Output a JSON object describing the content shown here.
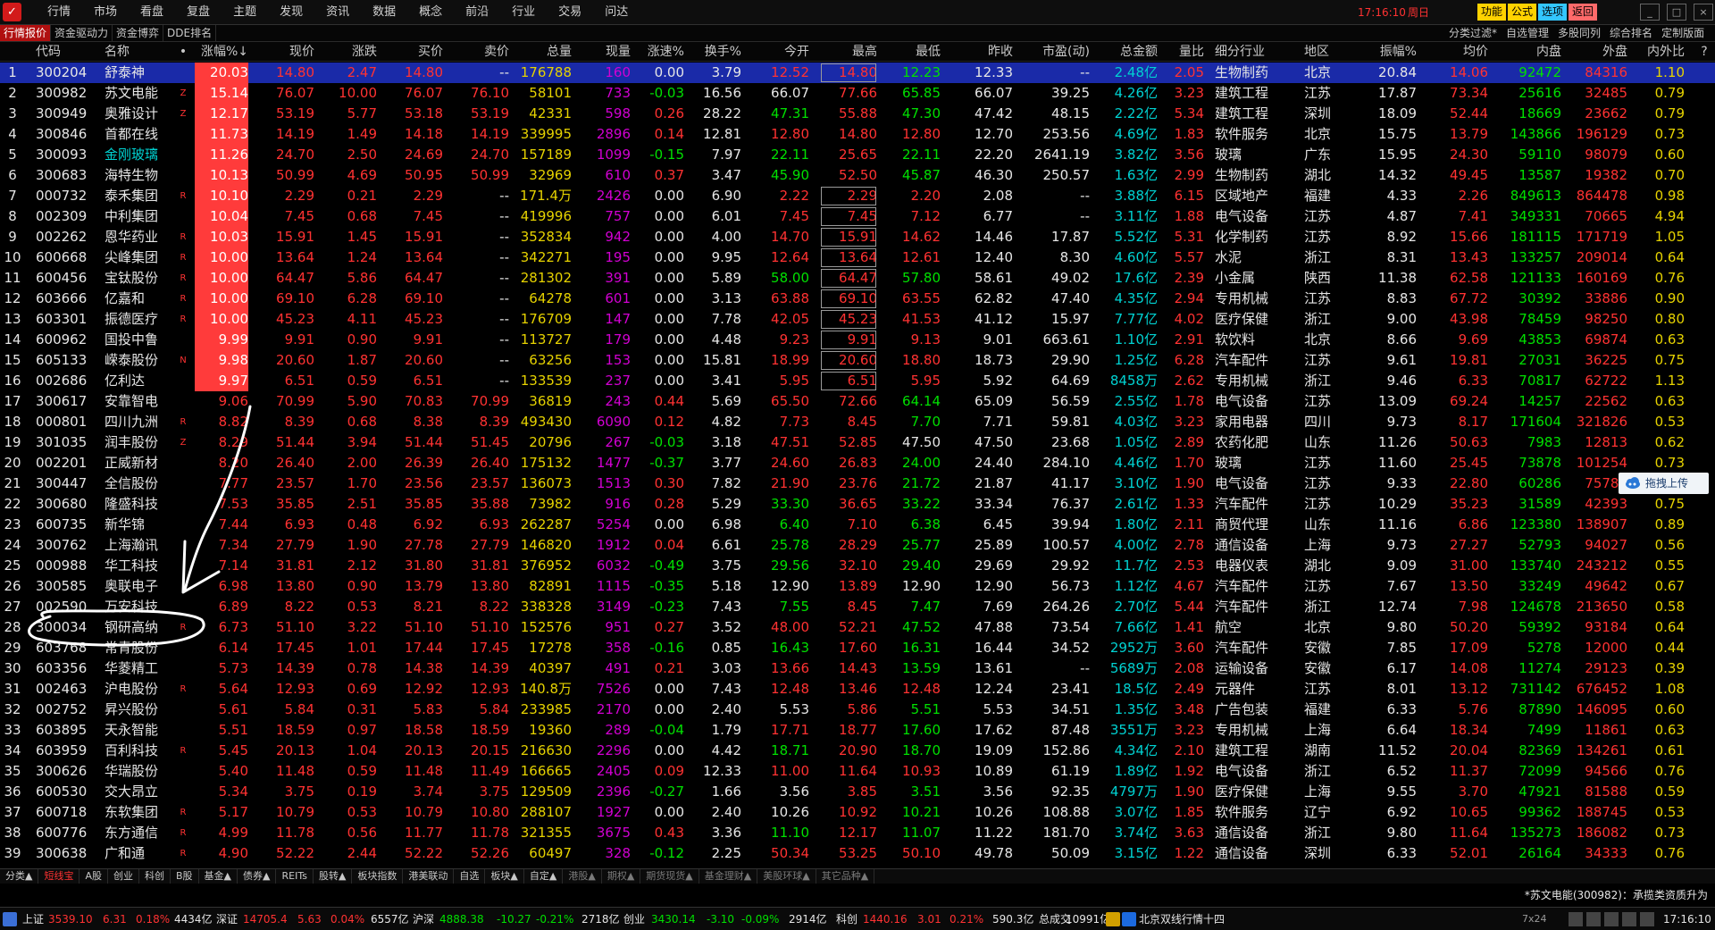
{
  "app": {
    "logo_text": "✓",
    "menu": [
      "行情",
      "市场",
      "看盘",
      "复盘",
      "主题",
      "发现",
      "资讯",
      "数据",
      "概念",
      "前沿",
      "行业",
      "交易",
      "问达"
    ],
    "time": "17:16:10",
    "weekday": "周日",
    "top_buttons": [
      {
        "label": "功能",
        "color": "#ffd200"
      },
      {
        "label": "公式",
        "color": "#ffd200"
      },
      {
        "label": "选项",
        "color": "#33c6ff"
      },
      {
        "label": "返回",
        "color": "#ff6a6a"
      }
    ],
    "window_controls": [
      "_",
      "□",
      "×"
    ]
  },
  "tabs": {
    "left": [
      "行情报价",
      "资金驱动力",
      "资金博弈",
      "DDE排名"
    ],
    "right": [
      "分类过滤*",
      "自选管理",
      "多股同列",
      "综合排名",
      "定制版面"
    ]
  },
  "table": {
    "headers": [
      "",
      "代码",
      "名称",
      "•",
      "涨幅%↓",
      "现价",
      "涨跌",
      "买价",
      "卖价",
      "总量",
      "现量",
      "涨速%",
      "换手%",
      "今开",
      "最高",
      "最低",
      "昨收",
      "市盈(动)",
      "总金额",
      "量比",
      "细分行业",
      "地区",
      "振幅%",
      "均价",
      "内盘",
      "外盘",
      "内外比",
      "?"
    ],
    "rows": [
      [
        "1",
        "300204",
        "舒泰神",
        "",
        "20.03",
        "14.80",
        "2.47",
        "14.80",
        "--",
        "176788",
        "160",
        "0.00",
        "3.79",
        "12.52",
        "14.80",
        "12.23",
        "12.33",
        "--",
        "2.48亿",
        "2.05",
        "生物制药",
        "北京",
        "20.84",
        "14.06",
        "92472",
        "84316",
        "1.10"
      ],
      [
        "2",
        "300982",
        "苏文电能",
        "Z",
        "15.14",
        "76.07",
        "10.00",
        "76.07",
        "76.10",
        "58101",
        "733",
        "-0.03",
        "16.56",
        "66.07",
        "77.66",
        "65.85",
        "66.07",
        "39.25",
        "4.26亿",
        "3.23",
        "建筑工程",
        "江苏",
        "17.87",
        "73.34",
        "25616",
        "32485",
        "0.79"
      ],
      [
        "3",
        "300949",
        "奥雅设计",
        "Z",
        "12.17",
        "53.19",
        "5.77",
        "53.18",
        "53.19",
        "42331",
        "598",
        "0.26",
        "28.22",
        "47.31",
        "55.88",
        "47.30",
        "47.42",
        "48.15",
        "2.22亿",
        "5.34",
        "建筑工程",
        "深圳",
        "18.09",
        "52.44",
        "18669",
        "23662",
        "0.79"
      ],
      [
        "4",
        "300846",
        "首都在线",
        "",
        "11.73",
        "14.19",
        "1.49",
        "14.18",
        "14.19",
        "339995",
        "2896",
        "0.14",
        "12.81",
        "12.80",
        "14.80",
        "12.80",
        "12.70",
        "253.56",
        "4.69亿",
        "1.83",
        "软件服务",
        "北京",
        "15.75",
        "13.79",
        "143866",
        "196129",
        "0.73"
      ],
      [
        "5",
        "300093",
        "金刚玻璃",
        "",
        "11.26",
        "24.70",
        "2.50",
        "24.69",
        "24.70",
        "157189",
        "1099",
        "-0.15",
        "7.97",
        "22.11",
        "25.65",
        "22.11",
        "22.20",
        "2641.19",
        "3.82亿",
        "3.56",
        "玻璃",
        "广东",
        "15.95",
        "24.30",
        "59110",
        "98079",
        "0.60"
      ],
      [
        "6",
        "300683",
        "海特生物",
        "",
        "10.13",
        "50.99",
        "4.69",
        "50.95",
        "50.99",
        "32969",
        "610",
        "0.37",
        "3.47",
        "45.90",
        "52.50",
        "45.87",
        "46.30",
        "250.57",
        "1.63亿",
        "2.99",
        "生物制药",
        "湖北",
        "14.32",
        "49.45",
        "13587",
        "19382",
        "0.70"
      ],
      [
        "7",
        "000732",
        "泰禾集团",
        "R",
        "10.10",
        "2.29",
        "0.21",
        "2.29",
        "--",
        "171.4万",
        "2426",
        "0.00",
        "6.90",
        "2.22",
        "2.29",
        "2.20",
        "2.08",
        "--",
        "3.88亿",
        "6.15",
        "区域地产",
        "福建",
        "4.33",
        "2.26",
        "849613",
        "864478",
        "0.98"
      ],
      [
        "8",
        "002309",
        "中利集团",
        "",
        "10.04",
        "7.45",
        "0.68",
        "7.45",
        "--",
        "419996",
        "757",
        "0.00",
        "6.01",
        "7.45",
        "7.45",
        "7.12",
        "6.77",
        "--",
        "3.11亿",
        "1.88",
        "电气设备",
        "江苏",
        "4.87",
        "7.41",
        "349331",
        "70665",
        "4.94"
      ],
      [
        "9",
        "002262",
        "恩华药业",
        "R",
        "10.03",
        "15.91",
        "1.45",
        "15.91",
        "--",
        "352834",
        "942",
        "0.00",
        "4.00",
        "14.70",
        "15.91",
        "14.62",
        "14.46",
        "17.87",
        "5.52亿",
        "5.31",
        "化学制药",
        "江苏",
        "8.92",
        "15.66",
        "181115",
        "171719",
        "1.05"
      ],
      [
        "10",
        "600668",
        "尖峰集团",
        "R",
        "10.00",
        "13.64",
        "1.24",
        "13.64",
        "--",
        "342271",
        "195",
        "0.00",
        "9.95",
        "12.64",
        "13.64",
        "12.61",
        "12.40",
        "8.30",
        "4.60亿",
        "5.57",
        "水泥",
        "浙江",
        "8.31",
        "13.43",
        "133257",
        "209014",
        "0.64"
      ],
      [
        "11",
        "600456",
        "宝钛股份",
        "R",
        "10.00",
        "64.47",
        "5.86",
        "64.47",
        "--",
        "281302",
        "391",
        "0.00",
        "5.89",
        "58.00",
        "64.47",
        "57.80",
        "58.61",
        "49.02",
        "17.6亿",
        "2.39",
        "小金属",
        "陕西",
        "11.38",
        "62.58",
        "121133",
        "160169",
        "0.76"
      ],
      [
        "12",
        "603666",
        "亿嘉和",
        "R",
        "10.00",
        "69.10",
        "6.28",
        "69.10",
        "--",
        "64278",
        "601",
        "0.00",
        "3.13",
        "63.88",
        "69.10",
        "63.55",
        "62.82",
        "47.40",
        "4.35亿",
        "2.94",
        "专用机械",
        "江苏",
        "8.83",
        "67.72",
        "30392",
        "33886",
        "0.90"
      ],
      [
        "13",
        "603301",
        "振德医疗",
        "R",
        "10.00",
        "45.23",
        "4.11",
        "45.23",
        "--",
        "176709",
        "147",
        "0.00",
        "7.78",
        "42.05",
        "45.23",
        "41.53",
        "41.12",
        "15.97",
        "7.77亿",
        "4.02",
        "医疗保健",
        "浙江",
        "9.00",
        "43.98",
        "78459",
        "98250",
        "0.80"
      ],
      [
        "14",
        "600962",
        "国投中鲁",
        "",
        "9.99",
        "9.91",
        "0.90",
        "9.91",
        "--",
        "113727",
        "179",
        "0.00",
        "4.48",
        "9.23",
        "9.91",
        "9.13",
        "9.01",
        "663.61",
        "1.10亿",
        "2.91",
        "软饮料",
        "北京",
        "8.66",
        "9.69",
        "43853",
        "69874",
        "0.63"
      ],
      [
        "15",
        "605133",
        "嵘泰股份",
        "N",
        "9.98",
        "20.60",
        "1.87",
        "20.60",
        "--",
        "63256",
        "153",
        "0.00",
        "15.81",
        "18.99",
        "20.60",
        "18.80",
        "18.73",
        "29.90",
        "1.25亿",
        "6.28",
        "汽车配件",
        "江苏",
        "9.61",
        "19.81",
        "27031",
        "36225",
        "0.75"
      ],
      [
        "16",
        "002686",
        "亿利达",
        "",
        "9.97",
        "6.51",
        "0.59",
        "6.51",
        "--",
        "133539",
        "237",
        "0.00",
        "3.41",
        "5.95",
        "6.51",
        "5.95",
        "5.92",
        "64.69",
        "8458万",
        "2.62",
        "专用机械",
        "浙江",
        "9.46",
        "6.33",
        "70817",
        "62722",
        "1.13"
      ],
      [
        "17",
        "300617",
        "安靠智电",
        "",
        "9.06",
        "70.99",
        "5.90",
        "70.83",
        "70.99",
        "36819",
        "243",
        "0.44",
        "5.69",
        "65.50",
        "72.66",
        "64.14",
        "65.09",
        "56.59",
        "2.55亿",
        "1.78",
        "电气设备",
        "江苏",
        "13.09",
        "69.24",
        "14257",
        "22562",
        "0.63"
      ],
      [
        "18",
        "000801",
        "四川九洲",
        "R",
        "8.82",
        "8.39",
        "0.68",
        "8.38",
        "8.39",
        "493430",
        "6090",
        "0.12",
        "4.82",
        "7.73",
        "8.45",
        "7.70",
        "7.71",
        "59.81",
        "4.03亿",
        "3.23",
        "家用电器",
        "四川",
        "9.73",
        "8.17",
        "171604",
        "321826",
        "0.53"
      ],
      [
        "19",
        "301035",
        "润丰股份",
        "Z",
        "8.29",
        "51.44",
        "3.94",
        "51.44",
        "51.45",
        "20796",
        "267",
        "-0.03",
        "3.18",
        "47.51",
        "52.85",
        "47.50",
        "47.50",
        "23.68",
        "1.05亿",
        "2.89",
        "农药化肥",
        "山东",
        "11.26",
        "50.63",
        "7983",
        "12813",
        "0.62"
      ],
      [
        "20",
        "002201",
        "正威新材",
        "",
        "8.20",
        "26.40",
        "2.00",
        "26.39",
        "26.40",
        "175132",
        "1477",
        "-0.37",
        "3.77",
        "24.60",
        "26.83",
        "24.00",
        "24.40",
        "284.10",
        "4.46亿",
        "1.70",
        "玻璃",
        "江苏",
        "11.60",
        "25.45",
        "73878",
        "101254",
        "0.73"
      ],
      [
        "21",
        "300447",
        "全信股份",
        "",
        "7.77",
        "23.57",
        "1.70",
        "23.56",
        "23.57",
        "136073",
        "1513",
        "0.30",
        "7.82",
        "21.90",
        "23.76",
        "21.72",
        "21.87",
        "41.17",
        "3.10亿",
        "1.90",
        "电气设备",
        "江苏",
        "9.33",
        "22.80",
        "60286",
        "75787",
        "0.80"
      ],
      [
        "22",
        "300680",
        "隆盛科技",
        "",
        "7.53",
        "35.85",
        "2.51",
        "35.85",
        "35.88",
        "73982",
        "916",
        "0.28",
        "5.29",
        "33.30",
        "36.65",
        "33.22",
        "33.34",
        "76.37",
        "2.61亿",
        "1.33",
        "汽车配件",
        "江苏",
        "10.29",
        "35.23",
        "31589",
        "42393",
        "0.75"
      ],
      [
        "23",
        "600735",
        "新华锦",
        "",
        "7.44",
        "6.93",
        "0.48",
        "6.92",
        "6.93",
        "262287",
        "5254",
        "0.00",
        "6.98",
        "6.40",
        "7.10",
        "6.38",
        "6.45",
        "39.94",
        "1.80亿",
        "2.11",
        "商贸代理",
        "山东",
        "11.16",
        "6.86",
        "123380",
        "138907",
        "0.89"
      ],
      [
        "24",
        "300762",
        "上海瀚讯",
        "",
        "7.34",
        "27.79",
        "1.90",
        "27.78",
        "27.79",
        "146820",
        "1912",
        "0.04",
        "6.61",
        "25.78",
        "28.29",
        "25.77",
        "25.89",
        "100.57",
        "4.00亿",
        "2.78",
        "通信设备",
        "上海",
        "9.73",
        "27.27",
        "52793",
        "94027",
        "0.56"
      ],
      [
        "25",
        "000988",
        "华工科技",
        "",
        "7.14",
        "31.81",
        "2.12",
        "31.80",
        "31.81",
        "376952",
        "6032",
        "-0.49",
        "3.75",
        "29.56",
        "32.10",
        "29.40",
        "29.69",
        "29.92",
        "11.7亿",
        "2.53",
        "电器仪表",
        "湖北",
        "9.09",
        "31.00",
        "133740",
        "243212",
        "0.55"
      ],
      [
        "26",
        "300585",
        "奥联电子",
        "",
        "6.98",
        "13.80",
        "0.90",
        "13.79",
        "13.80",
        "82891",
        "1115",
        "-0.35",
        "5.18",
        "12.90",
        "13.89",
        "12.90",
        "12.90",
        "56.73",
        "1.12亿",
        "4.67",
        "汽车配件",
        "江苏",
        "7.67",
        "13.50",
        "33249",
        "49642",
        "0.67"
      ],
      [
        "27",
        "002590",
        "万安科技",
        "",
        "6.89",
        "8.22",
        "0.53",
        "8.21",
        "8.22",
        "338328",
        "3149",
        "-0.23",
        "7.43",
        "7.55",
        "8.45",
        "7.47",
        "7.69",
        "264.26",
        "2.70亿",
        "5.44",
        "汽车配件",
        "浙江",
        "12.74",
        "7.98",
        "124678",
        "213650",
        "0.58"
      ],
      [
        "28",
        "300034",
        "钢研高纳",
        "R",
        "6.73",
        "51.10",
        "3.22",
        "51.10",
        "51.10",
        "152576",
        "951",
        "0.27",
        "3.52",
        "48.00",
        "52.21",
        "47.52",
        "47.88",
        "73.54",
        "7.66亿",
        "1.41",
        "航空",
        "北京",
        "9.80",
        "50.20",
        "59392",
        "93184",
        "0.64"
      ],
      [
        "29",
        "603768",
        "常青股份",
        "",
        "6.14",
        "17.45",
        "1.01",
        "17.44",
        "17.45",
        "17278",
        "358",
        "-0.16",
        "0.85",
        "16.43",
        "17.60",
        "16.31",
        "16.44",
        "34.52",
        "2952万",
        "3.60",
        "汽车配件",
        "安徽",
        "7.85",
        "17.09",
        "5278",
        "12000",
        "0.44"
      ],
      [
        "30",
        "603356",
        "华菱精工",
        "",
        "5.73",
        "14.39",
        "0.78",
        "14.38",
        "14.39",
        "40397",
        "491",
        "0.21",
        "3.03",
        "13.66",
        "14.43",
        "13.59",
        "13.61",
        "--",
        "5689万",
        "2.08",
        "运输设备",
        "安徽",
        "6.17",
        "14.08",
        "11274",
        "29123",
        "0.39"
      ],
      [
        "31",
        "002463",
        "沪电股份",
        "R",
        "5.64",
        "12.93",
        "0.69",
        "12.92",
        "12.93",
        "140.8万",
        "7526",
        "0.00",
        "7.43",
        "12.48",
        "13.46",
        "12.48",
        "12.24",
        "23.41",
        "18.5亿",
        "2.49",
        "元器件",
        "江苏",
        "8.01",
        "13.12",
        "731142",
        "676452",
        "1.08"
      ],
      [
        "32",
        "002752",
        "昇兴股份",
        "",
        "5.61",
        "5.84",
        "0.31",
        "5.83",
        "5.84",
        "233985",
        "2170",
        "0.00",
        "2.40",
        "5.53",
        "5.86",
        "5.51",
        "5.53",
        "34.51",
        "1.35亿",
        "3.48",
        "广告包装",
        "福建",
        "6.33",
        "5.76",
        "87890",
        "146095",
        "0.60"
      ],
      [
        "33",
        "603895",
        "天永智能",
        "",
        "5.51",
        "18.59",
        "0.97",
        "18.58",
        "18.59",
        "19360",
        "289",
        "-0.04",
        "1.79",
        "17.71",
        "18.77",
        "17.60",
        "17.62",
        "87.48",
        "3551万",
        "3.23",
        "专用机械",
        "上海",
        "6.64",
        "18.34",
        "7499",
        "11861",
        "0.63"
      ],
      [
        "34",
        "603959",
        "百利科技",
        "R",
        "5.45",
        "20.13",
        "1.04",
        "20.13",
        "20.15",
        "216630",
        "2296",
        "0.00",
        "4.42",
        "18.71",
        "20.90",
        "18.70",
        "19.09",
        "152.86",
        "4.34亿",
        "2.10",
        "建筑工程",
        "湖南",
        "11.52",
        "20.04",
        "82369",
        "134261",
        "0.61"
      ],
      [
        "35",
        "300626",
        "华瑞股份",
        "",
        "5.40",
        "11.48",
        "0.59",
        "11.48",
        "11.49",
        "166665",
        "2405",
        "0.09",
        "12.33",
        "11.00",
        "11.64",
        "10.93",
        "10.89",
        "61.19",
        "1.89亿",
        "1.92",
        "电气设备",
        "浙江",
        "6.52",
        "11.37",
        "72099",
        "94566",
        "0.76"
      ],
      [
        "36",
        "600530",
        "交大昂立",
        "",
        "5.34",
        "3.75",
        "0.19",
        "3.74",
        "3.75",
        "129509",
        "2396",
        "-0.27",
        "1.66",
        "3.56",
        "3.85",
        "3.51",
        "3.56",
        "92.35",
        "4797万",
        "1.90",
        "医疗保健",
        "上海",
        "9.55",
        "3.70",
        "47921",
        "81588",
        "0.59"
      ],
      [
        "37",
        "600718",
        "东软集团",
        "R",
        "5.17",
        "10.79",
        "0.53",
        "10.79",
        "10.80",
        "288107",
        "1927",
        "0.00",
        "2.40",
        "10.26",
        "10.92",
        "10.21",
        "10.26",
        "108.88",
        "3.07亿",
        "1.85",
        "软件服务",
        "辽宁",
        "6.92",
        "10.65",
        "99362",
        "188745",
        "0.53"
      ],
      [
        "38",
        "600776",
        "东方通信",
        "R",
        "4.99",
        "11.78",
        "0.56",
        "11.77",
        "11.78",
        "321355",
        "3675",
        "0.43",
        "3.36",
        "11.10",
        "12.17",
        "11.07",
        "11.22",
        "181.70",
        "3.74亿",
        "3.63",
        "通信设备",
        "浙江",
        "9.80",
        "11.64",
        "135273",
        "186082",
        "0.73"
      ],
      [
        "39",
        "300638",
        "广和通",
        "R",
        "4.90",
        "52.22",
        "2.44",
        "52.22",
        "52.26",
        "60497",
        "328",
        "-0.12",
        "2.25",
        "50.34",
        "53.25",
        "50.10",
        "49.78",
        "50.09",
        "3.15亿",
        "1.22",
        "通信设备",
        "深圳",
        "6.33",
        "52.01",
        "26164",
        "34333",
        "0.76"
      ]
    ]
  },
  "upload_button": {
    "label": "拖拽上传"
  },
  "bottom_tabs": [
    "分类▲",
    "短线宝",
    "A股",
    "创业",
    "科创",
    "B股",
    "基金▲",
    "债券▲",
    "REITs",
    "股转▲",
    "板块指数",
    "港美联动",
    "自选",
    "板块▲",
    "自定▲",
    "港股▲",
    "期权▲",
    "期货现货▲",
    "基金理财▲",
    "美股环球▲",
    "其它品种▲"
  ],
  "news_ticker": "*苏文电能(300982)：承揽类资质升为",
  "status_bar": {
    "sh_label": "上证",
    "sh_val": "3539.10",
    "sh_chg": "6.31",
    "sh_pct": "0.18%",
    "sh_amt": "4434亿",
    "sz_label": "深证",
    "sz_val": "14705.4",
    "sz_chg": "5.63",
    "sz_pct": "0.04%",
    "sz_amt": "6557亿",
    "hs_label": "沪深",
    "hs_val": "4888.38",
    "hs_chg": "-10.27",
    "hs_pct": "-0.21%",
    "hs_amt": "2718亿",
    "cy_label": "创业",
    "cy_val": "3430.14",
    "cy_chg": "-3.10",
    "cy_pct": "-0.09%",
    "cy_amt": "2914亿",
    "kc_label": "科创",
    "kc_val": "1440.16",
    "kc_chg": "3.01",
    "kc_pct": "0.21%",
    "kc_amt": "590.3亿",
    "total_label": "总成交",
    "total_val": "10991亿",
    "server": "北京双线行情十四",
    "badge": "7x24",
    "time": "17:16:10"
  }
}
